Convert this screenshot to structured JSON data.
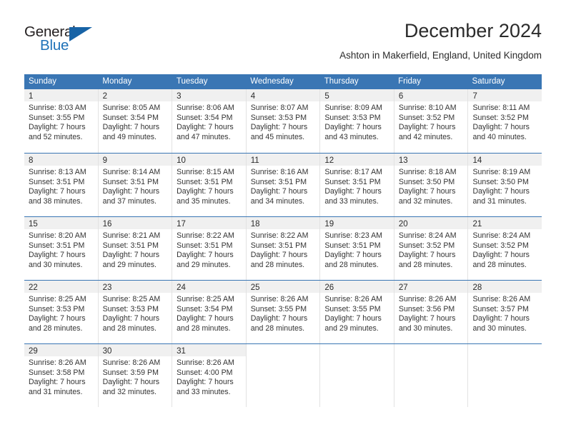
{
  "brand": {
    "line1": "General",
    "line2": "Blue",
    "flag_icon": "blue-flag-triangle",
    "color_dark": "#231f20",
    "color_blue": "#1f72b8"
  },
  "header": {
    "title": "December 2024",
    "location": "Ashton in Makerfield, England, United Kingdom"
  },
  "theme": {
    "header_blue": "#3a76b4",
    "daynum_band": "#f0f0f0",
    "grid_line": "#e2e2e2"
  },
  "calendar": {
    "weekday_headers": [
      "Sunday",
      "Monday",
      "Tuesday",
      "Wednesday",
      "Thursday",
      "Friday",
      "Saturday"
    ],
    "weeks": [
      [
        {
          "day": "1",
          "sunrise": "Sunrise: 8:03 AM",
          "sunset": "Sunset: 3:55 PM",
          "daylight_line1": "Daylight: 7 hours",
          "daylight_line2": "and 52 minutes."
        },
        {
          "day": "2",
          "sunrise": "Sunrise: 8:05 AM",
          "sunset": "Sunset: 3:54 PM",
          "daylight_line1": "Daylight: 7 hours",
          "daylight_line2": "and 49 minutes."
        },
        {
          "day": "3",
          "sunrise": "Sunrise: 8:06 AM",
          "sunset": "Sunset: 3:54 PM",
          "daylight_line1": "Daylight: 7 hours",
          "daylight_line2": "and 47 minutes."
        },
        {
          "day": "4",
          "sunrise": "Sunrise: 8:07 AM",
          "sunset": "Sunset: 3:53 PM",
          "daylight_line1": "Daylight: 7 hours",
          "daylight_line2": "and 45 minutes."
        },
        {
          "day": "5",
          "sunrise": "Sunrise: 8:09 AM",
          "sunset": "Sunset: 3:53 PM",
          "daylight_line1": "Daylight: 7 hours",
          "daylight_line2": "and 43 minutes."
        },
        {
          "day": "6",
          "sunrise": "Sunrise: 8:10 AM",
          "sunset": "Sunset: 3:52 PM",
          "daylight_line1": "Daylight: 7 hours",
          "daylight_line2": "and 42 minutes."
        },
        {
          "day": "7",
          "sunrise": "Sunrise: 8:11 AM",
          "sunset": "Sunset: 3:52 PM",
          "daylight_line1": "Daylight: 7 hours",
          "daylight_line2": "and 40 minutes."
        }
      ],
      [
        {
          "day": "8",
          "sunrise": "Sunrise: 8:13 AM",
          "sunset": "Sunset: 3:51 PM",
          "daylight_line1": "Daylight: 7 hours",
          "daylight_line2": "and 38 minutes."
        },
        {
          "day": "9",
          "sunrise": "Sunrise: 8:14 AM",
          "sunset": "Sunset: 3:51 PM",
          "daylight_line1": "Daylight: 7 hours",
          "daylight_line2": "and 37 minutes."
        },
        {
          "day": "10",
          "sunrise": "Sunrise: 8:15 AM",
          "sunset": "Sunset: 3:51 PM",
          "daylight_line1": "Daylight: 7 hours",
          "daylight_line2": "and 35 minutes."
        },
        {
          "day": "11",
          "sunrise": "Sunrise: 8:16 AM",
          "sunset": "Sunset: 3:51 PM",
          "daylight_line1": "Daylight: 7 hours",
          "daylight_line2": "and 34 minutes."
        },
        {
          "day": "12",
          "sunrise": "Sunrise: 8:17 AM",
          "sunset": "Sunset: 3:51 PM",
          "daylight_line1": "Daylight: 7 hours",
          "daylight_line2": "and 33 minutes."
        },
        {
          "day": "13",
          "sunrise": "Sunrise: 8:18 AM",
          "sunset": "Sunset: 3:50 PM",
          "daylight_line1": "Daylight: 7 hours",
          "daylight_line2": "and 32 minutes."
        },
        {
          "day": "14",
          "sunrise": "Sunrise: 8:19 AM",
          "sunset": "Sunset: 3:50 PM",
          "daylight_line1": "Daylight: 7 hours",
          "daylight_line2": "and 31 minutes."
        }
      ],
      [
        {
          "day": "15",
          "sunrise": "Sunrise: 8:20 AM",
          "sunset": "Sunset: 3:51 PM",
          "daylight_line1": "Daylight: 7 hours",
          "daylight_line2": "and 30 minutes."
        },
        {
          "day": "16",
          "sunrise": "Sunrise: 8:21 AM",
          "sunset": "Sunset: 3:51 PM",
          "daylight_line1": "Daylight: 7 hours",
          "daylight_line2": "and 29 minutes."
        },
        {
          "day": "17",
          "sunrise": "Sunrise: 8:22 AM",
          "sunset": "Sunset: 3:51 PM",
          "daylight_line1": "Daylight: 7 hours",
          "daylight_line2": "and 29 minutes."
        },
        {
          "day": "18",
          "sunrise": "Sunrise: 8:22 AM",
          "sunset": "Sunset: 3:51 PM",
          "daylight_line1": "Daylight: 7 hours",
          "daylight_line2": "and 28 minutes."
        },
        {
          "day": "19",
          "sunrise": "Sunrise: 8:23 AM",
          "sunset": "Sunset: 3:51 PM",
          "daylight_line1": "Daylight: 7 hours",
          "daylight_line2": "and 28 minutes."
        },
        {
          "day": "20",
          "sunrise": "Sunrise: 8:24 AM",
          "sunset": "Sunset: 3:52 PM",
          "daylight_line1": "Daylight: 7 hours",
          "daylight_line2": "and 28 minutes."
        },
        {
          "day": "21",
          "sunrise": "Sunrise: 8:24 AM",
          "sunset": "Sunset: 3:52 PM",
          "daylight_line1": "Daylight: 7 hours",
          "daylight_line2": "and 28 minutes."
        }
      ],
      [
        {
          "day": "22",
          "sunrise": "Sunrise: 8:25 AM",
          "sunset": "Sunset: 3:53 PM",
          "daylight_line1": "Daylight: 7 hours",
          "daylight_line2": "and 28 minutes."
        },
        {
          "day": "23",
          "sunrise": "Sunrise: 8:25 AM",
          "sunset": "Sunset: 3:53 PM",
          "daylight_line1": "Daylight: 7 hours",
          "daylight_line2": "and 28 minutes."
        },
        {
          "day": "24",
          "sunrise": "Sunrise: 8:25 AM",
          "sunset": "Sunset: 3:54 PM",
          "daylight_line1": "Daylight: 7 hours",
          "daylight_line2": "and 28 minutes."
        },
        {
          "day": "25",
          "sunrise": "Sunrise: 8:26 AM",
          "sunset": "Sunset: 3:55 PM",
          "daylight_line1": "Daylight: 7 hours",
          "daylight_line2": "and 28 minutes."
        },
        {
          "day": "26",
          "sunrise": "Sunrise: 8:26 AM",
          "sunset": "Sunset: 3:55 PM",
          "daylight_line1": "Daylight: 7 hours",
          "daylight_line2": "and 29 minutes."
        },
        {
          "day": "27",
          "sunrise": "Sunrise: 8:26 AM",
          "sunset": "Sunset: 3:56 PM",
          "daylight_line1": "Daylight: 7 hours",
          "daylight_line2": "and 30 minutes."
        },
        {
          "day": "28",
          "sunrise": "Sunrise: 8:26 AM",
          "sunset": "Sunset: 3:57 PM",
          "daylight_line1": "Daylight: 7 hours",
          "daylight_line2": "and 30 minutes."
        }
      ],
      [
        {
          "day": "29",
          "sunrise": "Sunrise: 8:26 AM",
          "sunset": "Sunset: 3:58 PM",
          "daylight_line1": "Daylight: 7 hours",
          "daylight_line2": "and 31 minutes."
        },
        {
          "day": "30",
          "sunrise": "Sunrise: 8:26 AM",
          "sunset": "Sunset: 3:59 PM",
          "daylight_line1": "Daylight: 7 hours",
          "daylight_line2": "and 32 minutes."
        },
        {
          "day": "31",
          "sunrise": "Sunrise: 8:26 AM",
          "sunset": "Sunset: 4:00 PM",
          "daylight_line1": "Daylight: 7 hours",
          "daylight_line2": "and 33 minutes."
        },
        {
          "day": "",
          "sunrise": "",
          "sunset": "",
          "daylight_line1": "",
          "daylight_line2": ""
        },
        {
          "day": "",
          "sunrise": "",
          "sunset": "",
          "daylight_line1": "",
          "daylight_line2": ""
        },
        {
          "day": "",
          "sunrise": "",
          "sunset": "",
          "daylight_line1": "",
          "daylight_line2": ""
        },
        {
          "day": "",
          "sunrise": "",
          "sunset": "",
          "daylight_line1": "",
          "daylight_line2": ""
        }
      ]
    ]
  }
}
